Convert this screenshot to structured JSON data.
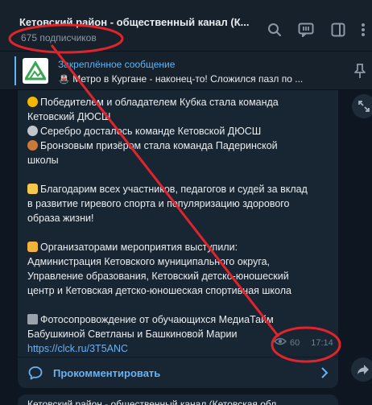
{
  "header": {
    "title": "Кетовский район - общественный канал (К...",
    "subscribers": "675 подписчиков",
    "icons": [
      "search-icon",
      "comments-icon",
      "sidebar-icon",
      "more-icon"
    ]
  },
  "pinned": {
    "label": "Закреплённое сообщение",
    "preview": "🚇 Метро в Кургане - наконец-то!  Сложился пазл по ..."
  },
  "message": {
    "lines": [
      "Победителем и обладателем Кубка стала команда",
      "Кетовский ДЮСШ",
      "Серебро досталось команде Кетовской ДЮСШ",
      "Бронзовым призёром стала команда Падеринской",
      "школы",
      "",
      "Благодарим всех участников, педагогов и судей за вклад",
      "в развитие гиревого спорта и популяризацию здорового",
      "образа жизни!",
      "",
      "Организаторами мероприятия выступили:",
      "Администрация Кетовского муниципального округа,",
      "Управление образования, Кетовский детско-юношеский",
      "центр и Кетовская детско-юношеская спортивная школа",
      "",
      "Фотосопровождение от обучающихся МедиаТайм",
      "Бабушкиной Светланы и Башкиновой Марии"
    ],
    "link": "https://clck.ru/3T5ANC",
    "views": "60",
    "time": "17:14",
    "comment_label": "Прокомментировать"
  },
  "next_message": {
    "title": "Кетовский район - общественный канал (Кетовская обл"
  },
  "colors": {
    "annotation": "#e0242c",
    "accent": "#5eb5f7",
    "link": "#6ab2f2"
  }
}
